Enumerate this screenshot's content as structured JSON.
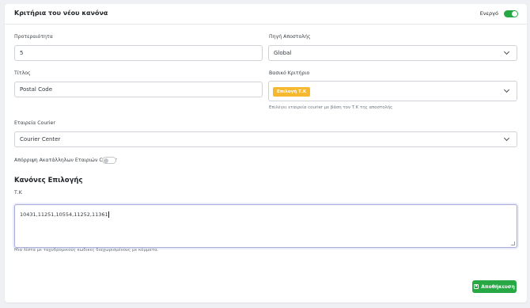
{
  "header": {
    "title": "Κριτήρια του νέου κανόνα",
    "active_label": "Ενεργό",
    "active_on": true
  },
  "form": {
    "priority": {
      "label": "Προτεραιότητα",
      "value": "5"
    },
    "source": {
      "label": "Πηγή Αποστολής",
      "value": "Global"
    },
    "title": {
      "label": "Τίτλος",
      "value": "Postal Code"
    },
    "base_criterion": {
      "label": "Βασικό Κριτήριο",
      "selected": "Επιλογή Τ.Κ",
      "help": "Επιλέγει εταιρεία courier με βάση τον Τ.Κ της αποστολής"
    },
    "courier": {
      "label": "Εταιρεία Courier",
      "value": "Courier Center"
    },
    "reject_unsuitable": {
      "label": "Απόρριψη Ακατάλληλων Εταιριών Courier",
      "on": false
    }
  },
  "rules": {
    "section_title": "Κανόνες Επιλογής",
    "postal_label": "Τ.Κ",
    "postal_value": "10431,11251,10554,11252,11361",
    "postal_help": "Μια λίστα με ταχυδρομικούς κωδικες διαχωρισμένους με κόμματα."
  },
  "actions": {
    "save_label": "Αποθήκευση"
  },
  "colors": {
    "accent": "#28a745",
    "chip": "#f5b82e"
  }
}
